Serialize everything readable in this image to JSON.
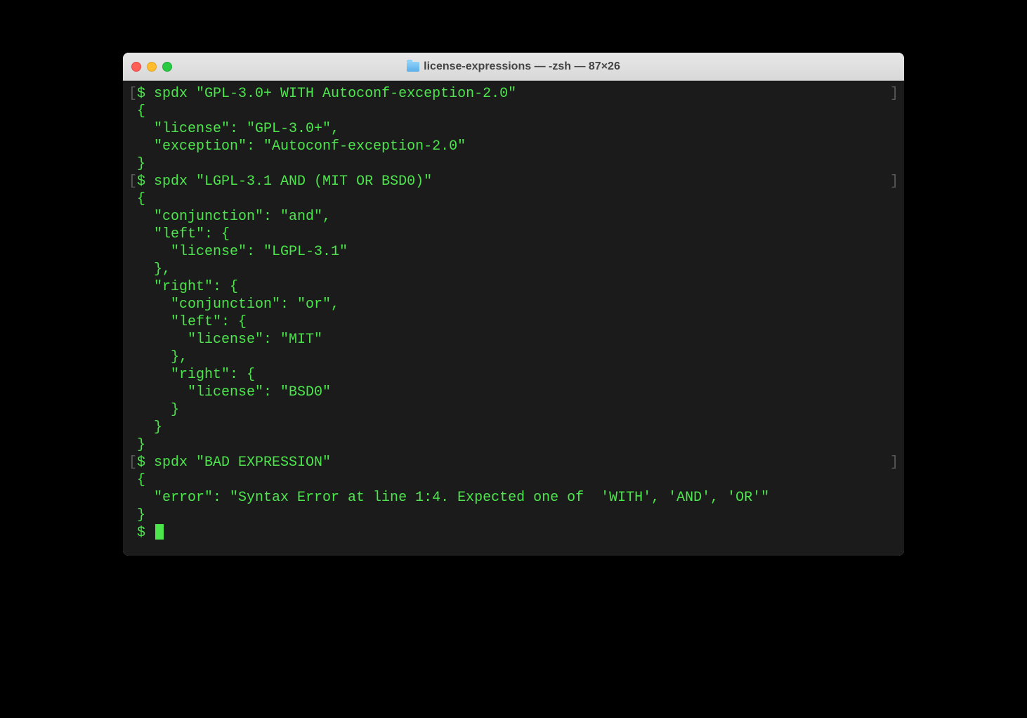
{
  "window": {
    "title": "license-expressions — -zsh — 87×26"
  },
  "terminal": {
    "lines": [
      {
        "type": "prompt",
        "text": "$ spdx \"GPL-3.0+ WITH Autoconf-exception-2.0\""
      },
      {
        "type": "output",
        "text": "{"
      },
      {
        "type": "output",
        "text": "  \"license\": \"GPL-3.0+\","
      },
      {
        "type": "output",
        "text": "  \"exception\": \"Autoconf-exception-2.0\""
      },
      {
        "type": "output",
        "text": "}"
      },
      {
        "type": "prompt",
        "text": "$ spdx \"LGPL-3.1 AND (MIT OR BSD0)\""
      },
      {
        "type": "output",
        "text": "{"
      },
      {
        "type": "output",
        "text": "  \"conjunction\": \"and\","
      },
      {
        "type": "output",
        "text": "  \"left\": {"
      },
      {
        "type": "output",
        "text": "    \"license\": \"LGPL-3.1\""
      },
      {
        "type": "output",
        "text": "  },"
      },
      {
        "type": "output",
        "text": "  \"right\": {"
      },
      {
        "type": "output",
        "text": "    \"conjunction\": \"or\","
      },
      {
        "type": "output",
        "text": "    \"left\": {"
      },
      {
        "type": "output",
        "text": "      \"license\": \"MIT\""
      },
      {
        "type": "output",
        "text": "    },"
      },
      {
        "type": "output",
        "text": "    \"right\": {"
      },
      {
        "type": "output",
        "text": "      \"license\": \"BSD0\""
      },
      {
        "type": "output",
        "text": "    }"
      },
      {
        "type": "output",
        "text": "  }"
      },
      {
        "type": "output",
        "text": "}"
      },
      {
        "type": "prompt",
        "text": "$ spdx \"BAD EXPRESSION\""
      },
      {
        "type": "output",
        "text": "{"
      },
      {
        "type": "output",
        "text": "  \"error\": \"Syntax Error at line 1:4. Expected one of  'WITH', 'AND', 'OR'\""
      },
      {
        "type": "output",
        "text": "}"
      },
      {
        "type": "cursor",
        "text": "$ "
      }
    ]
  },
  "colors": {
    "terminal_bg": "#1b1b1b",
    "terminal_fg": "#4ce64c",
    "bracket": "#5a5a5a"
  }
}
